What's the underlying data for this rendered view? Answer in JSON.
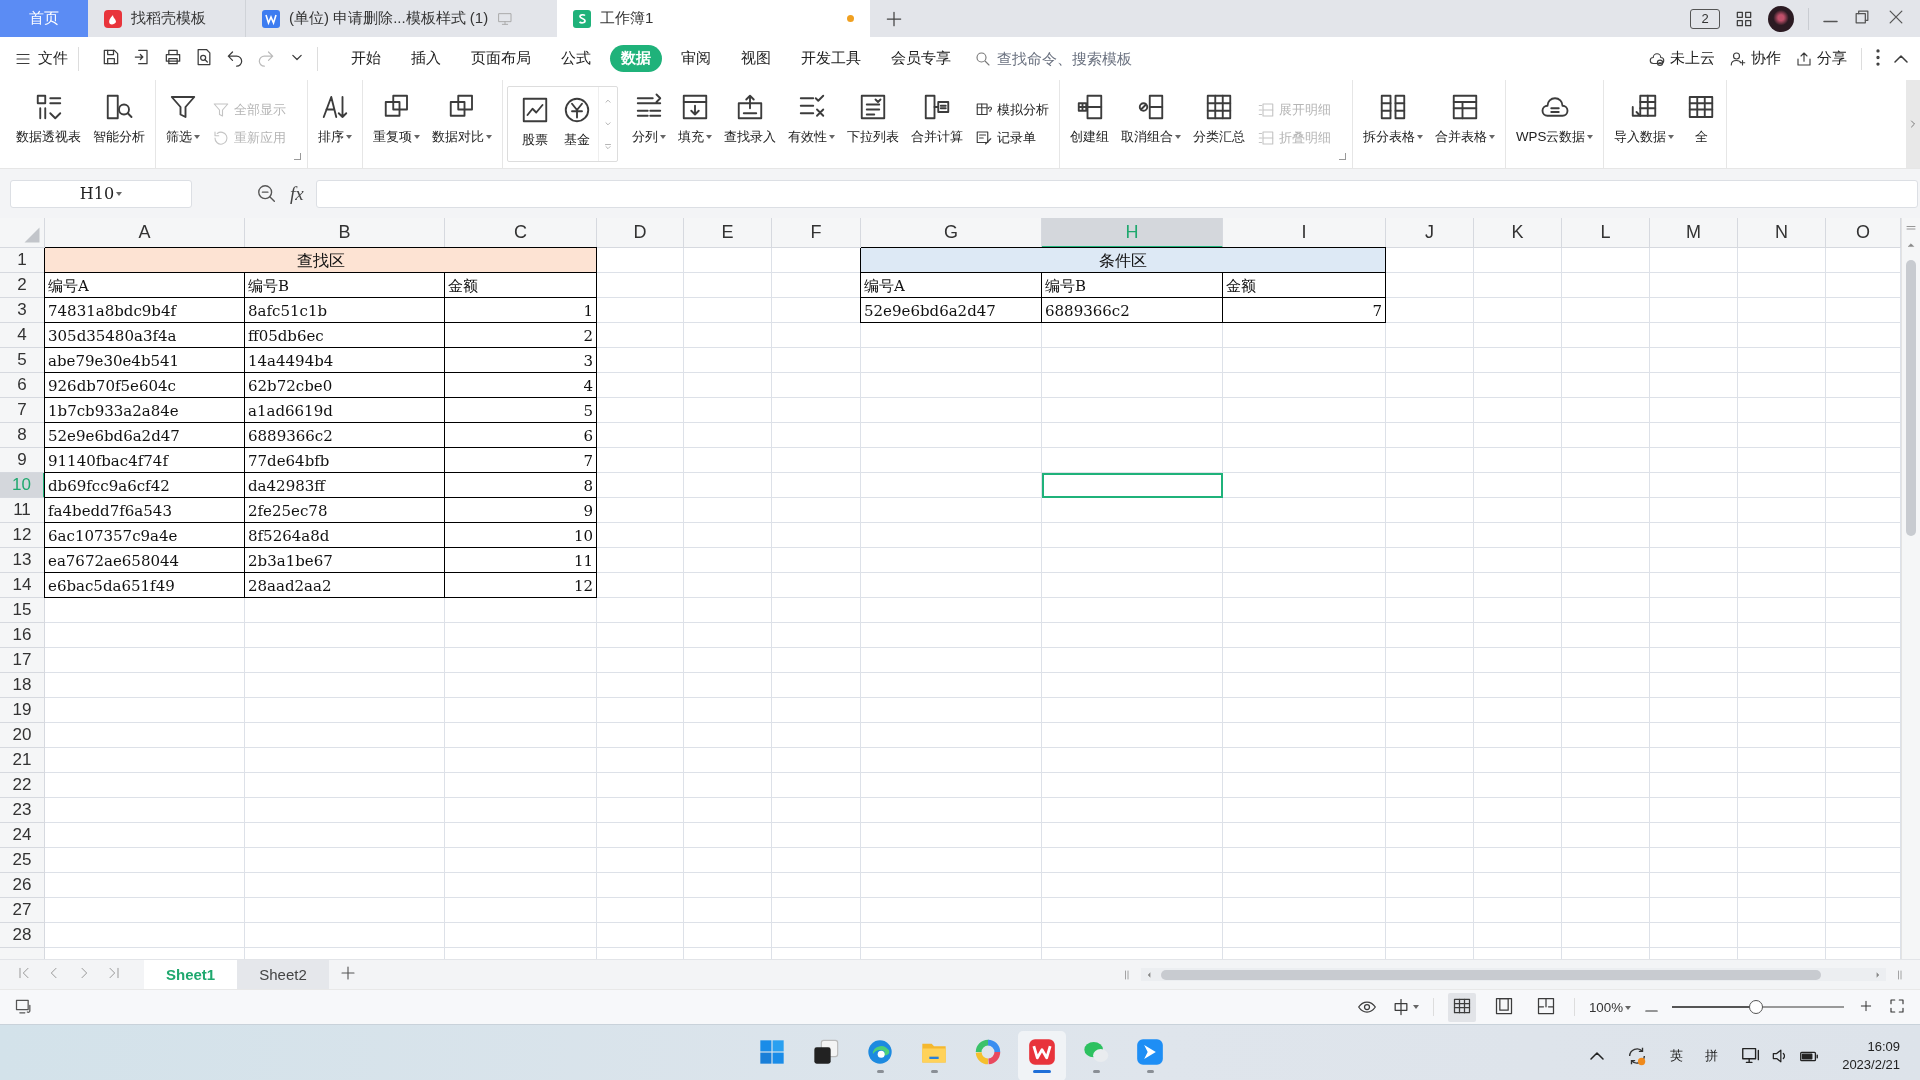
{
  "window": {
    "tabs": [
      {
        "label": "首页",
        "kind": "home",
        "selected": false,
        "unsaved": false
      },
      {
        "label": "找稻壳模板",
        "kind": "docer",
        "selected": false,
        "unsaved": false
      },
      {
        "label": "(单位)  申请删除...模板样式 (1)",
        "kind": "writer",
        "selected": false,
        "unsaved": false
      },
      {
        "label": "工作簿1",
        "kind": "sheet",
        "selected": true,
        "unsaved": true
      }
    ],
    "badge": "2"
  },
  "menubar": {
    "file": "文件",
    "tabs": [
      {
        "label": "开始",
        "selected": false
      },
      {
        "label": "插入",
        "selected": false
      },
      {
        "label": "页面布局",
        "selected": false
      },
      {
        "label": "公式",
        "selected": false
      },
      {
        "label": "数据",
        "selected": true
      },
      {
        "label": "审阅",
        "selected": false
      },
      {
        "label": "视图",
        "selected": false
      },
      {
        "label": "开发工具",
        "selected": false
      },
      {
        "label": "会员专享",
        "selected": false
      }
    ],
    "search": {
      "placeholder": "查找命令、搜索模板"
    },
    "actions": [
      "未上云",
      "协作",
      "分享"
    ]
  },
  "ribbon": {
    "groups": [
      {
        "kind": "plain",
        "launcher": false,
        "items": [
          {
            "label": "数据透视表",
            "kind": "large",
            "dropdown": false,
            "disabled": false
          },
          {
            "label": "智能分析",
            "kind": "large",
            "dropdown": false,
            "disabled": false
          }
        ]
      },
      {
        "kind": "plain",
        "launcher": true,
        "items": [
          {
            "label": "筛选",
            "kind": "large",
            "dropdown": true,
            "disabled": false
          },
          {
            "label": "全部显示",
            "kind": "small",
            "dropdown": false,
            "disabled": true
          },
          {
            "label": "重新应用",
            "kind": "small",
            "dropdown": false,
            "disabled": true
          }
        ]
      },
      {
        "kind": "plain",
        "launcher": false,
        "items": [
          {
            "label": "排序",
            "kind": "large",
            "dropdown": true,
            "disabled": false
          }
        ]
      },
      {
        "kind": "plain",
        "launcher": false,
        "items": [
          {
            "label": "重复项",
            "kind": "large",
            "dropdown": true,
            "disabled": false
          },
          {
            "label": "数据对比",
            "kind": "large",
            "dropdown": true,
            "disabled": false
          }
        ]
      },
      {
        "kind": "gallery",
        "launcher": false,
        "items": [
          {
            "label": "股票",
            "kind": "large",
            "dropdown": false,
            "disabled": false
          },
          {
            "label": "基金",
            "kind": "large",
            "dropdown": false,
            "disabled": false
          }
        ]
      },
      {
        "kind": "plain",
        "launcher": false,
        "items": [
          {
            "label": "分列",
            "kind": "large",
            "dropdown": true,
            "disabled": false
          },
          {
            "label": "填充",
            "kind": "large",
            "dropdown": true,
            "disabled": false
          },
          {
            "label": "查找录入",
            "kind": "large",
            "dropdown": false,
            "disabled": false
          },
          {
            "label": "有效性",
            "kind": "large",
            "dropdown": true,
            "disabled": false
          },
          {
            "label": "下拉列表",
            "kind": "large",
            "dropdown": false,
            "disabled": false
          },
          {
            "label": "合并计算",
            "kind": "large",
            "dropdown": false,
            "disabled": false
          },
          {
            "label": "模拟分析",
            "kind": "small",
            "dropdown": false,
            "disabled": false
          },
          {
            "label": "记录单",
            "kind": "small",
            "dropdown": false,
            "disabled": false
          }
        ]
      },
      {
        "kind": "plain",
        "launcher": true,
        "items": [
          {
            "label": "创建组",
            "kind": "large",
            "dropdown": false,
            "disabled": false
          },
          {
            "label": "取消组合",
            "kind": "large",
            "dropdown": true,
            "disabled": false
          },
          {
            "label": "分类汇总",
            "kind": "large",
            "dropdown": false,
            "disabled": false
          },
          {
            "label": "展开明细",
            "kind": "small",
            "dropdown": false,
            "disabled": true
          },
          {
            "label": "折叠明细",
            "kind": "small",
            "dropdown": false,
            "disabled": true
          }
        ]
      },
      {
        "kind": "plain",
        "launcher": false,
        "items": [
          {
            "label": "拆分表格",
            "kind": "large",
            "dropdown": true,
            "disabled": false
          },
          {
            "label": "合并表格",
            "kind": "large",
            "dropdown": true,
            "disabled": false
          }
        ]
      },
      {
        "kind": "plain",
        "launcher": false,
        "items": [
          {
            "label": "WPS云数据",
            "kind": "large",
            "dropdown": true,
            "disabled": false
          }
        ]
      },
      {
        "kind": "plain",
        "launcher": false,
        "items": [
          {
            "label": "导入数据",
            "kind": "large",
            "dropdown": true,
            "disabled": false
          },
          {
            "label": "全",
            "kind": "large",
            "dropdown": false,
            "disabled": false
          }
        ]
      }
    ]
  },
  "formula_bar": {
    "name_box": "H10",
    "function_label": "fx"
  },
  "sheet": {
    "columns": [
      {
        "label": "A",
        "selected": false
      },
      {
        "label": "B",
        "selected": false
      },
      {
        "label": "C",
        "selected": false
      },
      {
        "label": "D",
        "selected": false
      },
      {
        "label": "E",
        "selected": false
      },
      {
        "label": "F",
        "selected": false
      },
      {
        "label": "G",
        "selected": false
      },
      {
        "label": "H",
        "selected": true
      },
      {
        "label": "I",
        "selected": false
      },
      {
        "label": "J",
        "selected": false
      },
      {
        "label": "K",
        "selected": false
      },
      {
        "label": "L",
        "selected": false
      },
      {
        "label": "M",
        "selected": false
      },
      {
        "label": "N",
        "selected": false
      },
      {
        "label": "O",
        "selected": false
      }
    ],
    "rows": [
      {
        "label": "1",
        "selected": false
      },
      {
        "label": "2",
        "selected": false
      },
      {
        "label": "3",
        "selected": false
      },
      {
        "label": "4",
        "selected": false
      },
      {
        "label": "5",
        "selected": false
      },
      {
        "label": "6",
        "selected": false
      },
      {
        "label": "7",
        "selected": false
      },
      {
        "label": "8",
        "selected": false
      },
      {
        "label": "9",
        "selected": false
      },
      {
        "label": "10",
        "selected": true
      },
      {
        "label": "11",
        "selected": false
      },
      {
        "label": "12",
        "selected": false
      },
      {
        "label": "13",
        "selected": false
      },
      {
        "label": "14",
        "selected": false
      },
      {
        "label": "15",
        "selected": false
      },
      {
        "label": "16",
        "selected": false
      },
      {
        "label": "17",
        "selected": false
      },
      {
        "label": "18",
        "selected": false
      },
      {
        "label": "19",
        "selected": false
      },
      {
        "label": "20",
        "selected": false
      },
      {
        "label": "21",
        "selected": false
      },
      {
        "label": "22",
        "selected": false
      },
      {
        "label": "23",
        "selected": false
      },
      {
        "label": "24",
        "selected": false
      },
      {
        "label": "25",
        "selected": false
      },
      {
        "label": "26",
        "selected": false
      },
      {
        "label": "27",
        "selected": false
      },
      {
        "label": "28",
        "selected": false
      }
    ],
    "lookup_table": {
      "title": "查找区",
      "headers": [
        "编号A",
        "编号B",
        "金额"
      ],
      "rows": [
        [
          "74831a8bdc9b4f",
          "8afc51c1b",
          "1"
        ],
        [
          "305d35480a3f4a",
          "ff05db6ec",
          "2"
        ],
        [
          "abe79e30e4b541",
          "14a4494b4",
          "3"
        ],
        [
          "926db70f5e604c",
          "62b72cbe0",
          "4"
        ],
        [
          "1b7cb933a2a84e",
          "a1ad6619d",
          "5"
        ],
        [
          "52e9e6bd6a2d47",
          "6889366c2",
          "6"
        ],
        [
          "91140fbac4f74f",
          "77de64bfb",
          "7"
        ],
        [
          "db69fcc9a6cf42",
          "da42983ff",
          "8"
        ],
        [
          "fa4bedd7f6a543",
          "2fe25ec78",
          "9"
        ],
        [
          "6ac107357c9a4e",
          "8f5264a8d",
          "10"
        ],
        [
          "ea7672ae658044",
          "2b3a1be67",
          "11"
        ],
        [
          "e6bac5da651f49",
          "28aad2aa2",
          "12"
        ]
      ]
    },
    "criteria_table": {
      "title": "条件区",
      "headers": [
        "编号A",
        "编号B",
        "金额"
      ],
      "rows": [
        [
          "52e9e6bd6a2d47",
          "6889366c2",
          "7"
        ]
      ]
    }
  },
  "sheet_tabs": [
    {
      "label": "Sheet1",
      "selected": true
    },
    {
      "label": "Sheet2",
      "selected": false
    }
  ],
  "status_bar": {
    "views": [
      {
        "selected": true
      },
      {
        "selected": false
      },
      {
        "selected": false
      }
    ],
    "zoom": "100%",
    "zoom_slider": {
      "level": 0.49
    }
  },
  "taskbar": {
    "apps": [
      {
        "kind": "start",
        "running": false,
        "active": false
      },
      {
        "kind": "taskview",
        "running": false,
        "active": false
      },
      {
        "kind": "edge",
        "running": true,
        "active": false
      },
      {
        "kind": "explorer",
        "running": true,
        "active": false
      },
      {
        "kind": "colorwheel",
        "running": false,
        "active": false
      },
      {
        "kind": "wps",
        "running": true,
        "active": true
      },
      {
        "kind": "wechat",
        "running": true,
        "active": false
      },
      {
        "kind": "feishu",
        "running": true,
        "active": false
      }
    ],
    "ime": "英",
    "input_mode": "拼",
    "time": "16:09",
    "date": "2023/2/21"
  }
}
